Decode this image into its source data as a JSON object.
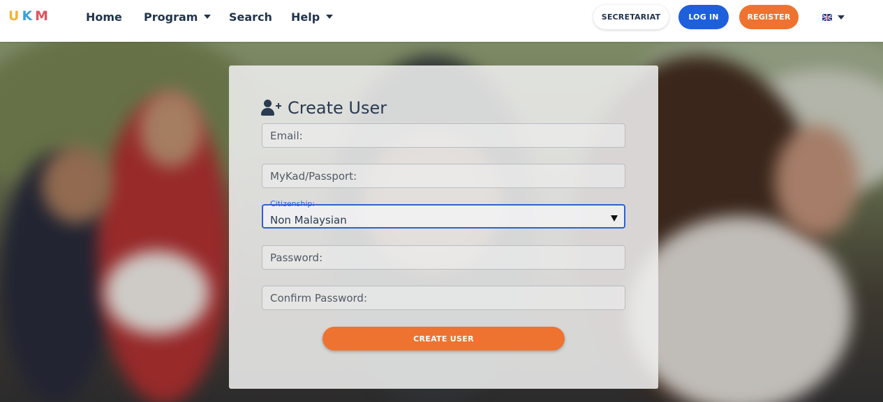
{
  "logo": {
    "letters": [
      "U",
      "K",
      "M"
    ],
    "colors": [
      "#f2b33d",
      "#3ba0d8",
      "#e0525c"
    ]
  },
  "nav": {
    "home": "Home",
    "program": "Program",
    "search": "Search",
    "help": "Help"
  },
  "header_buttons": {
    "secretariat": "SECRETARIAT",
    "login": "LOG IN",
    "register": "REGISTER",
    "language_icon": "uk-flag-icon"
  },
  "form": {
    "title": "Create User",
    "title_icon": "user-plus-icon",
    "email_placeholder": "Email:",
    "mykad_placeholder": "MyKad/Passport:",
    "citizenship_label": "Citizenship:",
    "citizenship_value": "Non Malaysian",
    "password_placeholder": "Password:",
    "confirm_password_placeholder": "Confirm Password:",
    "submit_label": "CREATE USER"
  },
  "colors": {
    "primary_blue": "#1e5fdc",
    "accent_orange": "#ee7330",
    "text_dark": "#22344d"
  }
}
